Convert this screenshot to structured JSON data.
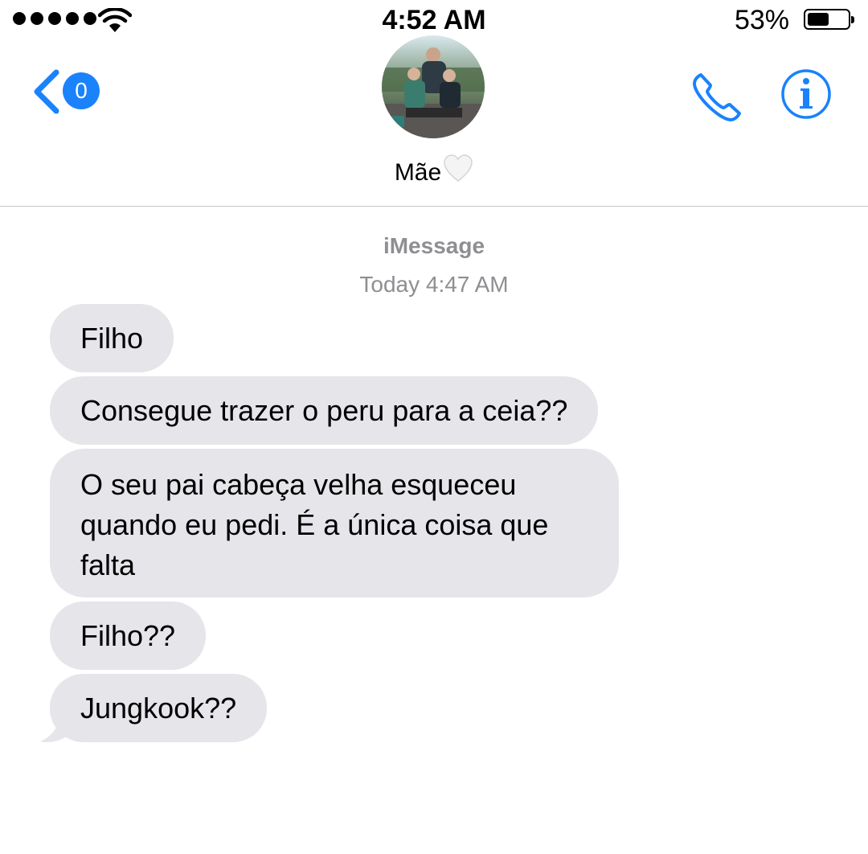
{
  "status_bar": {
    "time": "4:52 AM",
    "battery_percent": "53%",
    "battery_level": 0.53,
    "signal_bars": 5,
    "icons": [
      "signal-dots-icon",
      "wifi-icon",
      "battery-icon"
    ]
  },
  "header": {
    "back_badge": "0",
    "contact_name": "Mãe",
    "contact_emoji": "white-heart",
    "icons": [
      "chevron-left-icon",
      "phone-icon",
      "info-icon"
    ],
    "accent_color": "#1a82fb"
  },
  "conversation": {
    "service": "iMessage",
    "timestamp": "Today 4:47 AM",
    "messages": [
      {
        "text": "Filho",
        "direction": "incoming"
      },
      {
        "text": "Consegue trazer o peru para a ceia??",
        "direction": "incoming"
      },
      {
        "text": "O seu pai cabeça velha esqueceu quando eu pedi. É a única coisa que falta",
        "direction": "incoming"
      },
      {
        "text": "Filho??",
        "direction": "incoming"
      },
      {
        "text": "Jungkook??",
        "direction": "incoming"
      }
    ],
    "bubble_color": "#e5e5ea"
  }
}
